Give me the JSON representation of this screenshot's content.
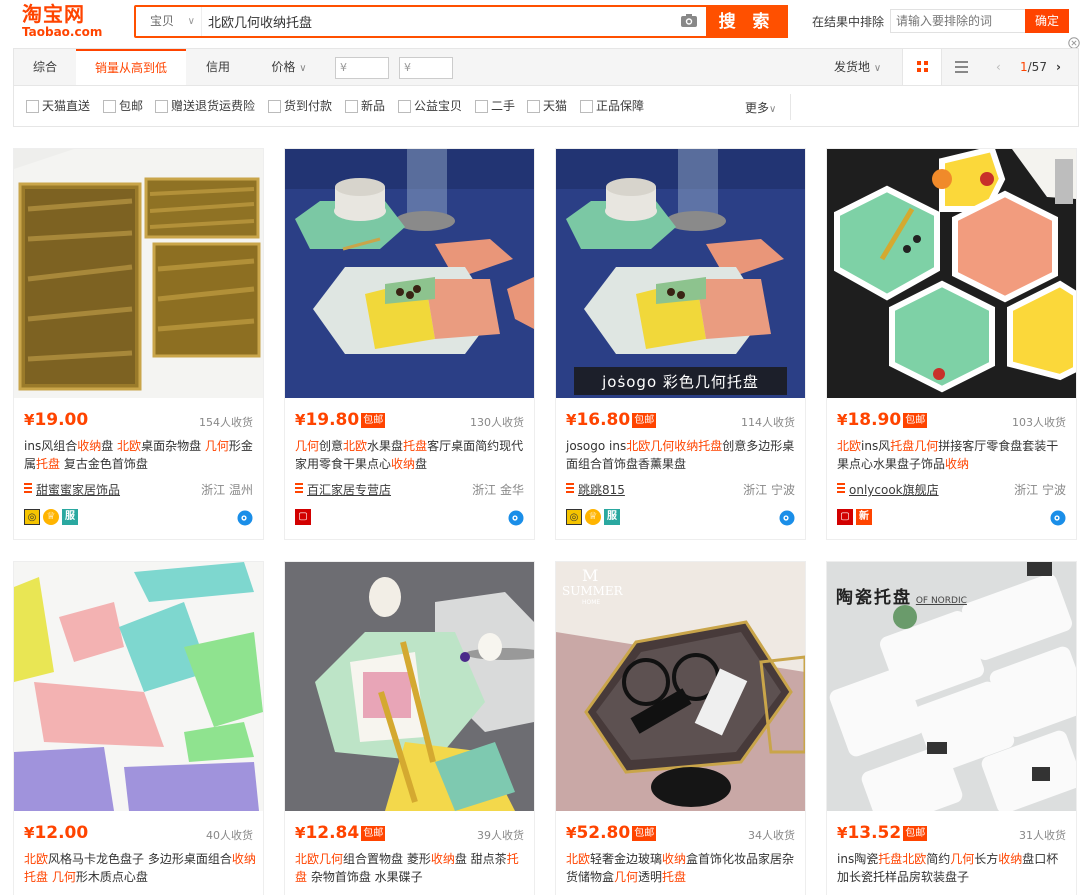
{
  "logo": {
    "cn": "淘宝网",
    "en": "Taobao.com"
  },
  "search": {
    "scope": "宝贝",
    "query": "北欧几何收纳托盘",
    "button_label": "搜 索",
    "exclude_label": "在结果中排除",
    "exclude_placeholder": "请输入要排除的词",
    "exclude_button": "确定"
  },
  "sort": {
    "tabs": [
      "综合",
      "销量从高到低",
      "信用",
      "价格"
    ],
    "active_index": 1,
    "price_from": "¥",
    "price_to": "¥",
    "price_dash": "-",
    "ship_from": "发货地",
    "page_current": "1",
    "page_total": "/57"
  },
  "filters": {
    "items": [
      "天猫直送",
      "包邮",
      "赠送退货运费险",
      "货到付款",
      "新品",
      "公益宝贝",
      "二手",
      "天猫",
      "正品保障"
    ],
    "more": "更多"
  },
  "colors": {
    "accent": "#ff4400",
    "brand": "#ff5000"
  },
  "products": [
    {
      "price": "19.00",
      "free_ship": false,
      "sales": "154人收货",
      "title": [
        [
          "ins风组合",
          false
        ],
        [
          "收纳",
          true
        ],
        [
          "盘 ",
          false
        ],
        [
          "北欧",
          true
        ],
        [
          "桌面杂物盘 ",
          false
        ],
        [
          "几何",
          true
        ],
        [
          "形金属",
          false
        ],
        [
          "托盘",
          true
        ],
        [
          " 复古金色首饰盘",
          false
        ]
      ],
      "shop": "甜蜜蜜家居饰品",
      "location": "浙江 温州",
      "badges": [
        "gold",
        "crown",
        "service"
      ]
    },
    {
      "price": "19.80",
      "free_ship": true,
      "sales": "130人收货",
      "title": [
        [
          "几何",
          true
        ],
        [
          "创意",
          false
        ],
        [
          "北欧",
          true
        ],
        [
          "水果盘",
          false
        ],
        [
          "托盘",
          true
        ],
        [
          "客厅桌面简约现代家用零食干果点心",
          false
        ],
        [
          "收纳",
          true
        ],
        [
          "盘",
          false
        ]
      ],
      "shop": "百汇家居专营店",
      "location": "浙江 金华",
      "badges": [
        "tmall"
      ]
    },
    {
      "price": "16.80",
      "free_ship": true,
      "sales": "114人收货",
      "title": [
        [
          "josogo ins",
          false
        ],
        [
          "北欧几何收纳托盘",
          true
        ],
        [
          "创意多边形桌面组合首饰盘香薰果盘",
          false
        ]
      ],
      "shop": "跳跳815",
      "location": "浙江 宁波",
      "badges": [
        "gold",
        "crown",
        "service"
      ],
      "image_caption": "joṡogo  彩色几何托盘"
    },
    {
      "price": "18.90",
      "free_ship": true,
      "sales": "103人收货",
      "title": [
        [
          "北欧",
          true
        ],
        [
          "ins风",
          false
        ],
        [
          "托盘几何",
          true
        ],
        [
          "拼接客厅零食盘套装干果点心水果盘子饰品",
          false
        ],
        [
          "收纳",
          true
        ]
      ],
      "shop": "onlycook旗舰店",
      "location": "浙江 宁波",
      "badges": [
        "tmall",
        "new"
      ]
    },
    {
      "price": "12.00",
      "free_ship": false,
      "sales": "40人收货",
      "title": [
        [
          "北欧",
          true
        ],
        [
          "风格马卡龙色盘子 多边形桌面组合",
          false
        ],
        [
          "收纳托盘 几何",
          true
        ],
        [
          "形木质点心盘",
          false
        ]
      ],
      "shop": "",
      "location": "",
      "badges": []
    },
    {
      "price": "12.84",
      "free_ship": true,
      "sales": "39人收货",
      "title": [
        [
          "北欧几何",
          true
        ],
        [
          "组合置物盘 菱形",
          false
        ],
        [
          "收纳",
          true
        ],
        [
          "盘 甜点茶",
          false
        ],
        [
          "托盘",
          true
        ],
        [
          " 杂物首饰盘 水果碟子",
          false
        ]
      ],
      "shop": "",
      "location": "",
      "badges": []
    },
    {
      "price": "52.80",
      "free_ship": true,
      "sales": "34人收货",
      "title": [
        [
          "北欧",
          true
        ],
        [
          "轻奢金边玻璃",
          false
        ],
        [
          "收纳",
          true
        ],
        [
          "盒首饰化妆品家居杂货储物盒",
          false
        ],
        [
          "几何",
          true
        ],
        [
          "透明",
          false
        ],
        [
          "托盘",
          true
        ]
      ],
      "shop": "",
      "location": "",
      "badges": [],
      "image_brand": {
        "mark": "M",
        "name": "SUMMER",
        "sub": "HOME"
      }
    },
    {
      "price": "13.52",
      "free_ship": true,
      "sales": "31人收货",
      "title": [
        [
          "ins陶瓷",
          false
        ],
        [
          "托盘北欧",
          true
        ],
        [
          "简约",
          false
        ],
        [
          "几何",
          true
        ],
        [
          "长方",
          false
        ],
        [
          "收纳",
          true
        ],
        [
          "盘口杯加长瓷托样品房软装盘子",
          false
        ]
      ],
      "shop": "",
      "location": "",
      "badges": [],
      "image_caption": "陶瓷托盘",
      "image_caption_sub": "OF NORDIC"
    }
  ],
  "labels": {
    "free_ship": "包邮",
    "yen": "¥",
    "new_badge": "新",
    "service_badge": "服"
  }
}
